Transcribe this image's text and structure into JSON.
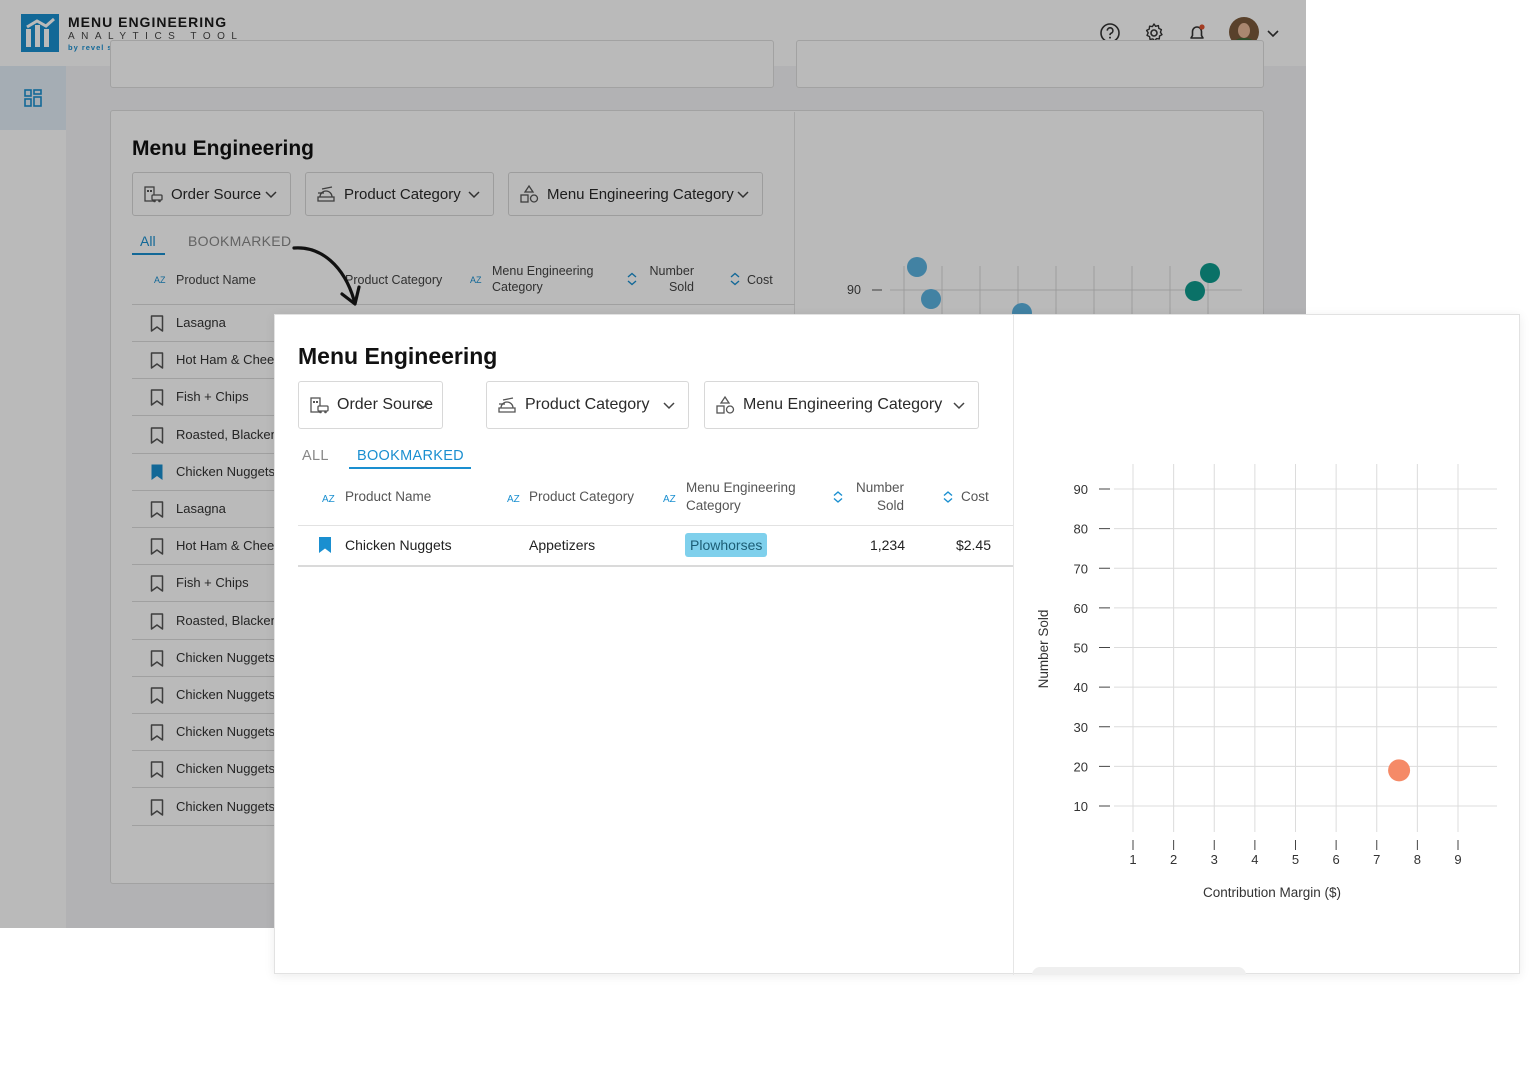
{
  "app": {
    "logo_title": "MENU ENGINEERING",
    "logo_subtitle": "ANALYTICS TOOL",
    "logo_by": "by revel systems"
  },
  "background_view": {
    "title": "Menu Engineering",
    "filters": [
      "Order Source",
      "Product Category",
      "Menu Engineering Category"
    ],
    "tabs": {
      "all": "All",
      "bookmarked": "BOOKMARKED",
      "active": "all"
    },
    "columns": [
      "Product Name",
      "Product Category",
      "Menu Engineering Category",
      "Number Sold",
      "Cost"
    ],
    "rows": [
      {
        "name": "Lasagna",
        "bookmarked": false
      },
      {
        "name": "Hot Ham & Cheese",
        "bookmarked": false
      },
      {
        "name": "Fish + Chips",
        "bookmarked": false
      },
      {
        "name": "Roasted, Blackened",
        "bookmarked": false
      },
      {
        "name": "Chicken Nuggets",
        "bookmarked": true
      },
      {
        "name": "Lasagna",
        "bookmarked": false
      },
      {
        "name": "Hot Ham & Cheese",
        "bookmarked": false
      },
      {
        "name": "Fish + Chips",
        "bookmarked": false
      },
      {
        "name": "Roasted, Blackened",
        "bookmarked": false
      },
      {
        "name": "Chicken Nuggets",
        "bookmarked": false
      },
      {
        "name": "Chicken Nuggets",
        "bookmarked": false
      },
      {
        "name": "Chicken Nuggets",
        "bookmarked": false
      },
      {
        "name": "Chicken Nuggets",
        "bookmarked": false
      },
      {
        "name": "Chicken Nuggets",
        "bookmarked": false
      }
    ],
    "chart_tick_90": "90"
  },
  "front_view": {
    "title": "Menu Engineering",
    "filters": [
      "Order Source",
      "Product Category",
      "Menu Engineering Category"
    ],
    "tabs": {
      "all": "ALL",
      "bookmarked": "BOOKMARKED",
      "active": "bookmarked"
    },
    "columns": {
      "product_name": "Product Name",
      "product_category": "Product Category",
      "me_category_line1": "Menu Engineering",
      "me_category_line2": "Category",
      "number_sold_line1": "Number",
      "number_sold_line2": "Sold",
      "cost": "Cost"
    },
    "rows": [
      {
        "name": "Chicken Nuggets",
        "category": "Appetizers",
        "me_category": "Plowhorses",
        "number_sold": "1,234",
        "cost": "$2.45",
        "bookmarked": true
      }
    ]
  },
  "colors": {
    "accent": "#1a8fd0",
    "badge_bg": "#7fd0ec",
    "point_orange": "#f58a67",
    "point_teal": "#0f9b8e",
    "point_lightblue": "#5bb3e0"
  },
  "chart_data": {
    "type": "scatter",
    "xlabel": "Contribution Margin ($)",
    "ylabel": "Number Sold",
    "x_ticks": [
      1,
      2,
      3,
      4,
      5,
      6,
      7,
      8,
      9
    ],
    "y_ticks": [
      10,
      20,
      30,
      40,
      50,
      60,
      70,
      80,
      90
    ],
    "xlim": [
      1,
      9
    ],
    "ylim": [
      10,
      90
    ],
    "grid": true,
    "points": [
      {
        "x": 7.55,
        "y": 19,
        "label": "Chicken Nuggets"
      }
    ]
  }
}
